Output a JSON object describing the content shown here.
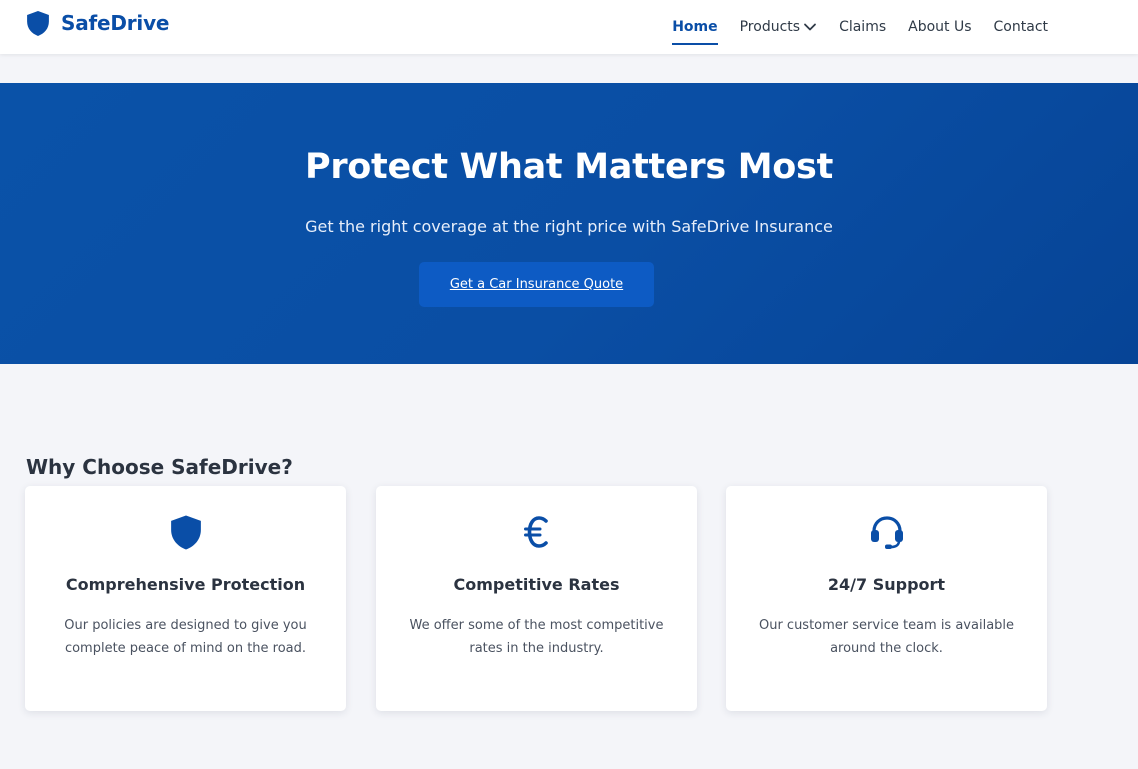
{
  "brand": {
    "name": "SafeDrive",
    "logo_icon": "shield-icon",
    "accent_color": "#0a4ea7"
  },
  "nav": {
    "items": [
      {
        "label": "Home",
        "active": true
      },
      {
        "label": "Products",
        "has_dropdown": true,
        "icon": "chevron-down-icon"
      },
      {
        "label": "Claims"
      },
      {
        "label": "About Us"
      },
      {
        "label": "Contact"
      }
    ]
  },
  "hero": {
    "title": "Protect What Matters Most",
    "subtitle": "Get the right coverage at the right price with SafeDrive Insurance",
    "cta_label": "Get a Car Insurance Quote",
    "background_color": "#0a4ea7"
  },
  "features": {
    "heading": "Why Choose SafeDrive?",
    "cards": [
      {
        "icon": "shield-icon",
        "title": "Comprehensive Protection",
        "text": "Our policies are designed to give you complete peace of mind on the road."
      },
      {
        "icon": "euro-icon",
        "title": "Competitive Rates",
        "text": "We offer some of the most competitive rates in the industry."
      },
      {
        "icon": "headset-icon",
        "title": "24/7 Support",
        "text": "Our customer service team is available around the clock."
      }
    ]
  }
}
